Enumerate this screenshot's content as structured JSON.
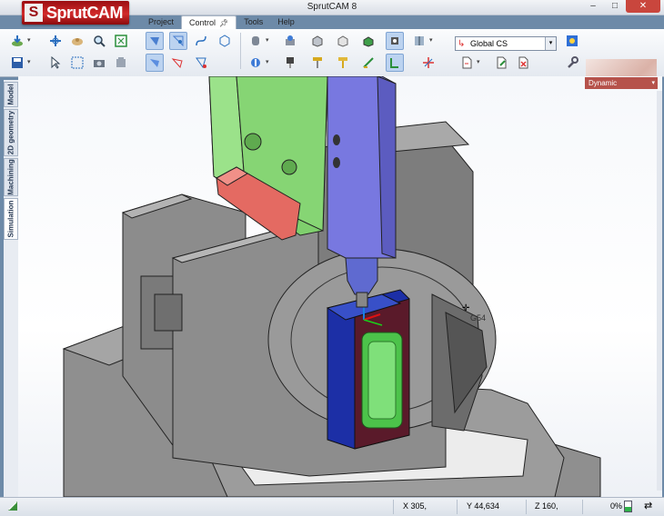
{
  "window": {
    "title": "SprutCAM 8",
    "brand_logo": "SprutCAM",
    "controls": [
      "minimize",
      "maximize",
      "close"
    ]
  },
  "menu": {
    "items": [
      {
        "label": "Project",
        "active": false
      },
      {
        "label": "Control",
        "active": true
      },
      {
        "label": "Tools",
        "active": false
      },
      {
        "label": "Help",
        "active": false
      }
    ],
    "pin_icon": "pin-icon"
  },
  "toolbar": {
    "coordinate_system": {
      "value": "Global CS",
      "icon": "coordinate-system-icon"
    },
    "view_mode": {
      "value": "Dynamic"
    }
  },
  "side_tabs": [
    {
      "label": "Model",
      "active": false
    },
    {
      "label": "2D geometry",
      "active": false
    },
    {
      "label": "Machining",
      "active": false
    },
    {
      "label": "Simulation",
      "active": true
    }
  ],
  "viewport": {
    "work_offset_label": "G54"
  },
  "status": {
    "x": "X 305,",
    "y": "Y 44,634",
    "z": "Z 160,",
    "progress_text": "0%",
    "progress_fraction": 0.5,
    "colors": {
      "progress": "#2fb24a",
      "accent": "#b6524b"
    }
  }
}
